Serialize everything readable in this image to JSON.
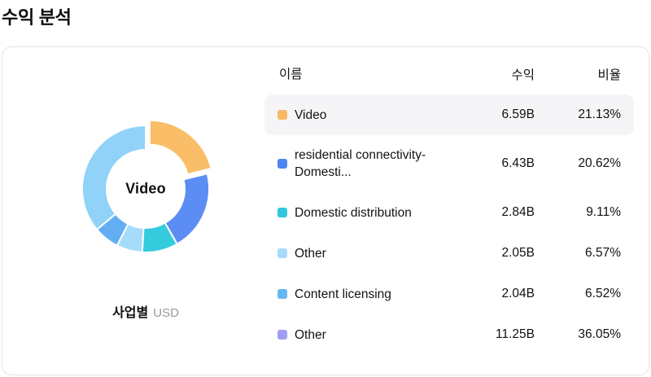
{
  "page_title": "수익 분석",
  "card": {
    "center_label": "Video",
    "caption": {
      "primary": "사업별",
      "secondary": "USD"
    },
    "table": {
      "columns": {
        "name": "이름",
        "revenue": "수익",
        "ratio": "비율"
      },
      "rows": [
        {
          "name": "Video",
          "revenue": "6.59B",
          "ratio": "21.13%",
          "swatch": "#F8B966",
          "selected": true
        },
        {
          "name": "residential connectivity-Domesti...",
          "revenue": "6.43B",
          "ratio": "20.62%",
          "swatch": "#4D86F1",
          "selected": false
        },
        {
          "name": "Domestic distribution",
          "revenue": "2.84B",
          "ratio": "9.11%",
          "swatch": "#30C9DB",
          "selected": false
        },
        {
          "name": "Other",
          "revenue": "2.05B",
          "ratio": "6.57%",
          "swatch": "#A6DCF9",
          "selected": false
        },
        {
          "name": "Content licensing",
          "revenue": "2.04B",
          "ratio": "6.52%",
          "swatch": "#67B7F6",
          "selected": false
        },
        {
          "name": "Other",
          "revenue": "11.25B",
          "ratio": "36.05%",
          "swatch": "#A09EF2",
          "selected": false
        }
      ]
    }
  },
  "chart_data": {
    "type": "pie",
    "title": "수익 분석",
    "group_label": "사업별",
    "unit": "USD",
    "center_text": "Video",
    "start_angle_deg": 0,
    "direction": "clockwise",
    "inner_radius_ratio": 0.61,
    "legend_position": "right",
    "segments": [
      {
        "label": "Video",
        "value_b": 6.59,
        "percent": 21.13,
        "color": "#F9BE67",
        "exploded": true
      },
      {
        "label": "residential connectivity-Domesti...",
        "value_b": 6.43,
        "percent": 20.62,
        "color": "#5B8DF4",
        "exploded": false
      },
      {
        "label": "Domestic distribution",
        "value_b": 2.84,
        "percent": 9.11,
        "color": "#35CBDE",
        "exploded": false
      },
      {
        "label": "Other",
        "value_b": 2.05,
        "percent": 6.57,
        "color": "#A6DCF9",
        "exploded": false
      },
      {
        "label": "Content licensing",
        "value_b": 2.04,
        "percent": 6.52,
        "color": "#63AEF2",
        "exploded": false
      },
      {
        "label": "Other",
        "value_b": 11.25,
        "percent": 36.05,
        "color": "#90D2F8",
        "exploded": false
      }
    ]
  }
}
